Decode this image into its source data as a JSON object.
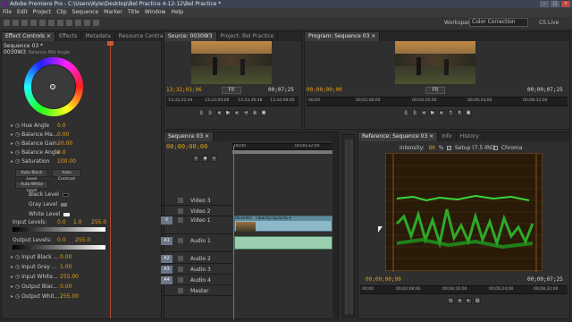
{
  "window": {
    "title": "Adobe Premiere Pro - C:\\Users\\Kyle\\Desktop\\Bel Practice 4-12-12\\Bel Practice *"
  },
  "menu": [
    "File",
    "Edit",
    "Project",
    "Clip",
    "Sequence",
    "Marker",
    "Title",
    "Window",
    "Help"
  ],
  "workspace": {
    "label": "Workspace:",
    "value": "Color Correction",
    "cs_live": "CS Live"
  },
  "effect_controls": {
    "tabs": [
      "Effect Controls ×",
      "Effects",
      "Metadata",
      "Resource Central"
    ],
    "sequence_label": "Sequence 03 * 0030W3",
    "wheel_label": "Balance Mid Angle",
    "params": [
      {
        "label": "Hue Angle",
        "value": "0.0"
      },
      {
        "label": "Balance Ma...",
        "value": "0.00"
      },
      {
        "label": "Balance Gain",
        "value": "20.00"
      },
      {
        "label": "Balance Angle",
        "value": "0.0"
      },
      {
        "label": "Saturation",
        "value": "100.00"
      }
    ],
    "buttons": [
      "Auto Black Level",
      "Auto Contrast",
      "Auto White Level"
    ],
    "levels": [
      {
        "label": "Black Level",
        "color": "#111111"
      },
      {
        "label": "Gray Level",
        "color": "#777777"
      },
      {
        "label": "White Level",
        "color": "#f0f0f0"
      }
    ],
    "input_levels": {
      "label": "Input Levels:",
      "v1": "0.0",
      "v2": "1.0",
      "v3": "255.0"
    },
    "output_levels": {
      "label": "Output Levels:",
      "v1": "0.0",
      "v2": "255.0"
    },
    "sub_params": [
      {
        "label": "Input Black ...",
        "value": "0.00"
      },
      {
        "label": "Input Gray ...",
        "value": "1.00"
      },
      {
        "label": "Input White...",
        "value": "255.00"
      },
      {
        "label": "Output Blac...",
        "value": "0.00"
      },
      {
        "label": "Output Whit...",
        "value": "255.00"
      }
    ]
  },
  "source": {
    "tabs": [
      "Source: 0030W3",
      "Project: Bel Practice"
    ],
    "tc_left": "13;32;03;06",
    "fit": "Fit",
    "tc_right": "00;07;25",
    "ruler": [
      "23;30;12;04",
      "13;32;22;04",
      "13;33;00;06",
      "13;33;36;48",
      "13;34;08;00",
      "13;34;28;00"
    ]
  },
  "program": {
    "tabs": [
      "Program: Sequence 03 ×"
    ],
    "tc_left": "00;00;00;00",
    "fit": "Fit",
    "tc_right": "00;00;07;25",
    "ruler": [
      "00;00",
      "00;02;08;00",
      "00;04;16;00",
      "00;06;24;00",
      "00;08;32;00"
    ]
  },
  "timeline": {
    "tab": "Sequence 03 ×",
    "tc": "00;00;00;00",
    "ruler": [
      "00;00",
      "00;00;32;00"
    ],
    "tracks": [
      {
        "name": "Video 3",
        "kind": "video",
        "label": ""
      },
      {
        "name": "Video 2",
        "kind": "video",
        "label": ""
      },
      {
        "name": "Video 1",
        "kind": "video",
        "label": "V"
      },
      {
        "name": "Audio 1",
        "kind": "audio",
        "label": "A1"
      },
      {
        "name": "Audio 2",
        "kind": "audio",
        "label": "A2"
      },
      {
        "name": "Audio 3",
        "kind": "audio",
        "label": "A3"
      },
      {
        "name": "Audio 4",
        "kind": "audio",
        "label": "A4"
      },
      {
        "name": "Master",
        "kind": "master",
        "label": ""
      }
    ],
    "clip": {
      "name": "0030W3",
      "fx": "Opacity:Opacity ▾"
    }
  },
  "reference": {
    "tabs": [
      "Reference: Sequence 03 ×",
      "Info",
      "History"
    ],
    "intensity_label": "Intensity:",
    "intensity": "80",
    "intensity_unit": "%",
    "setup_label": "Setup (7.5 IRE)",
    "chroma_label": "Chroma",
    "tc_left": "00;00;00;00",
    "tc_right": "00;00;07;25",
    "ruler": [
      "00;00",
      "00;02;08;00",
      "00;04;16;00",
      "00;06;24;00",
      "00;08;32;00"
    ]
  }
}
